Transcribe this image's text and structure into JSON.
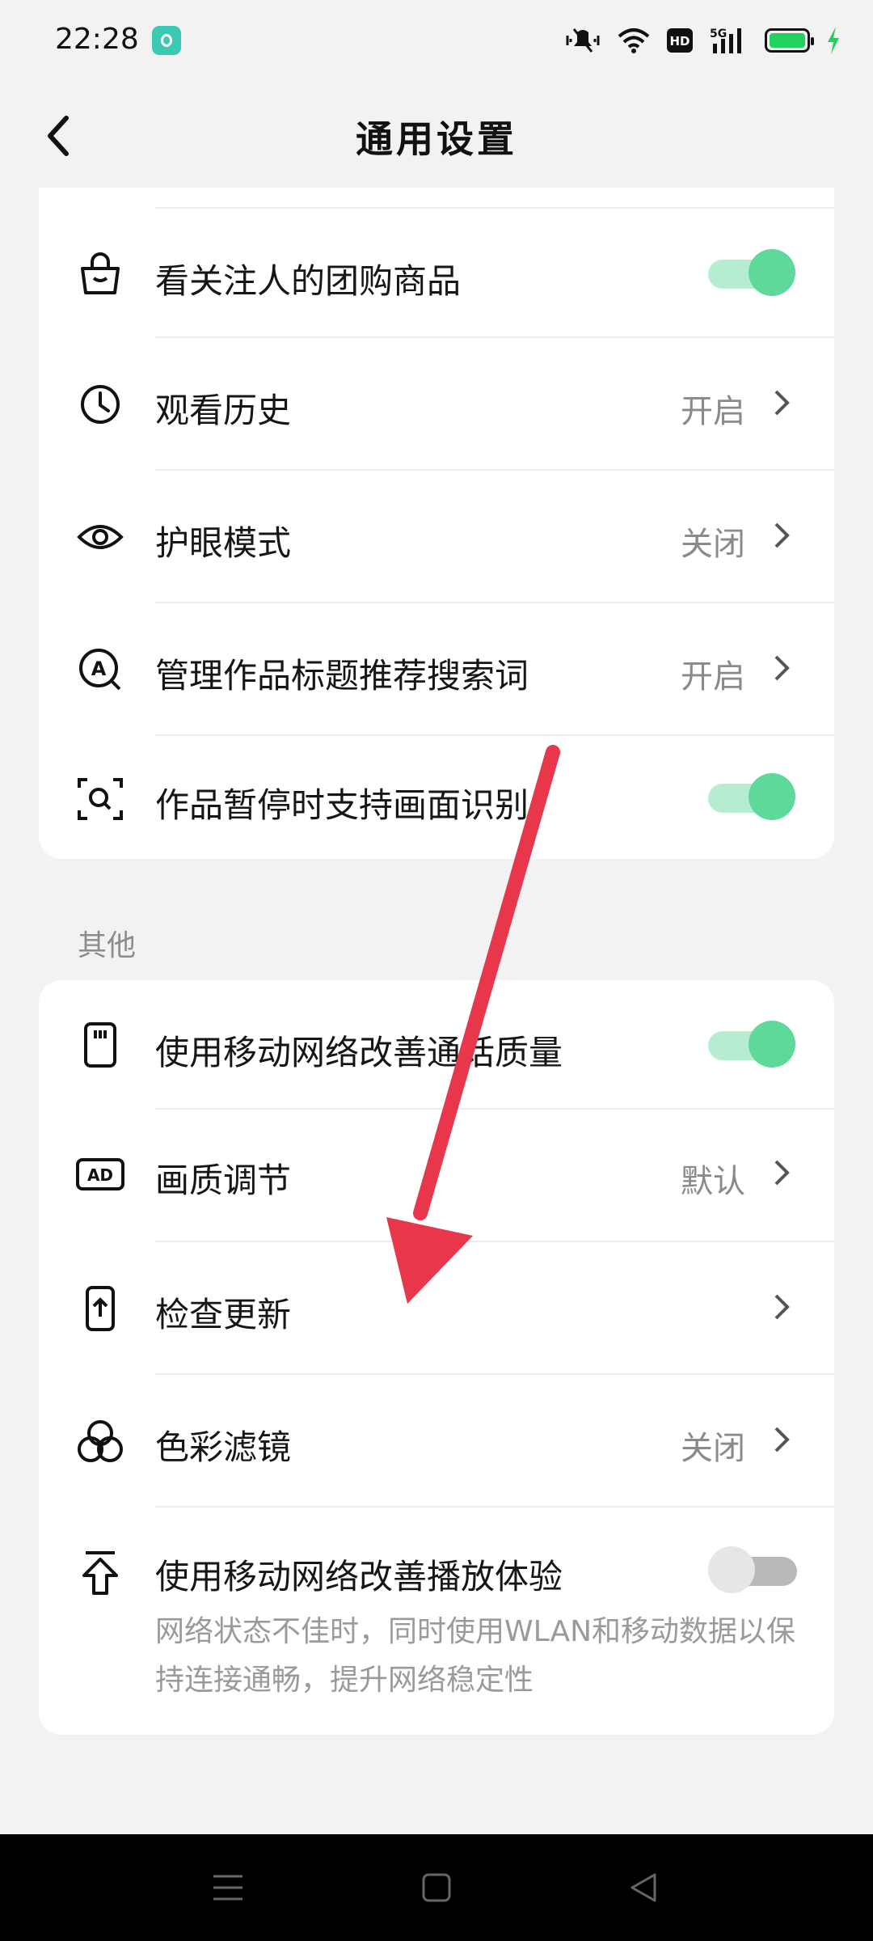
{
  "status_bar": {
    "time": "22:28",
    "network": "5G",
    "hd": "HD"
  },
  "header": {
    "title": "通用设置"
  },
  "section1": {
    "items": [
      {
        "label": "看关注人的团购商品",
        "type": "toggle",
        "on": true
      },
      {
        "label": "观看历史",
        "value": "开启"
      },
      {
        "label": "护眼模式",
        "value": "关闭"
      },
      {
        "label": "管理作品标题推荐搜索词",
        "value": "开启"
      },
      {
        "label": "作品暂停时支持画面识别",
        "type": "toggle",
        "on": true
      }
    ]
  },
  "section2": {
    "title": "其他",
    "items": [
      {
        "label": "使用移动网络改善通话质量",
        "type": "toggle",
        "on": true
      },
      {
        "label": "画质调节",
        "value": "默认"
      },
      {
        "label": "检查更新",
        "value": ""
      },
      {
        "label": "色彩滤镜",
        "value": "关闭"
      },
      {
        "label": "使用移动网络改善播放体验",
        "type": "toggle",
        "on": false,
        "description": "网络状态不佳时，同时使用WLAN和移动数据以保持连接通畅，提升网络稳定性"
      }
    ]
  },
  "colors": {
    "toggle_on": "#5fd99a",
    "toggle_track_on": "#b6edd1",
    "annotation_arrow": "#e8364a"
  }
}
